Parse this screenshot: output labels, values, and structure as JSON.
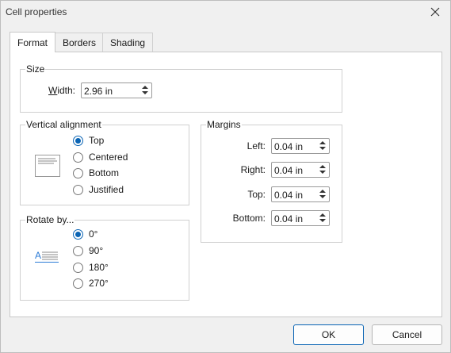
{
  "dialog": {
    "title": "Cell properties"
  },
  "tabs": [
    {
      "label": "Format",
      "active": true
    },
    {
      "label": "Borders",
      "active": false
    },
    {
      "label": "Shading",
      "active": false
    }
  ],
  "size": {
    "group_label": "Size",
    "width_label": "Width:",
    "width_value": "2.96 in"
  },
  "vertical_alignment": {
    "group_label": "Vertical alignment",
    "options": [
      {
        "label": "Top",
        "checked": true
      },
      {
        "label": "Centered",
        "checked": false
      },
      {
        "label": "Bottom",
        "checked": false
      },
      {
        "label": "Justified",
        "checked": false
      }
    ]
  },
  "rotate_by": {
    "group_label": "Rotate by...",
    "preview_letter": "A",
    "options": [
      {
        "label": "0°",
        "checked": true
      },
      {
        "label": "90°",
        "checked": false
      },
      {
        "label": "180°",
        "checked": false
      },
      {
        "label": "270°",
        "checked": false
      }
    ]
  },
  "margins": {
    "group_label": "Margins",
    "fields": [
      {
        "label": "Left:",
        "value": "0.04 in"
      },
      {
        "label": "Right:",
        "value": "0.04 in"
      },
      {
        "label": "Top:",
        "value": "0.04 in"
      },
      {
        "label": "Bottom:",
        "value": "0.04 in"
      }
    ]
  },
  "buttons": {
    "ok": "OK",
    "cancel": "Cancel"
  },
  "colors": {
    "accent": "#0a64b4",
    "preview_text": "#2b7bd6"
  }
}
